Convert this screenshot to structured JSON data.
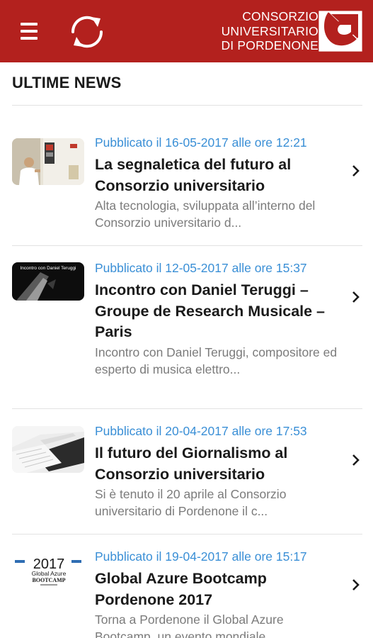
{
  "header": {
    "logo_lines": [
      "CONSORZIO",
      "UNIVERSITARIO",
      "DI PORDENONE"
    ],
    "brand_color": "#b3211e",
    "menu_icon": "hamburger-menu-icon",
    "refresh_icon": "refresh-icon"
  },
  "section": {
    "title": "ULTIME NEWS"
  },
  "news": [
    {
      "date": "Pubblicato il 16-05-2017 alle ore 12:21",
      "title": "La segnaletica del futuro al Consorzio universitario",
      "excerpt": "Alta tecnologia, sviluppata all’interno del Consorzio universitario d..."
    },
    {
      "date": "Pubblicato il 12-05-2017 alle ore 15:37",
      "title": "Incontro con Daniel Teruggi – Groupe de Research Musicale – Paris",
      "excerpt": "Incontro con Daniel Teruggi, compositore ed esperto di musica elettro...",
      "thumb_caption": "Incontro con Daniel Teruggi"
    },
    {
      "date": "Pubblicato il 20-04-2017 alle ore 17:53",
      "title": "Il futuro del Giornalismo al Consorzio universitario",
      "excerpt": "Si è tenuto il 20 aprile al Consorzio universitario di Pordenone il c..."
    },
    {
      "date": "Pubblicato il 19-04-2017 alle ore 15:17",
      "title": "Global Azure Bootcamp Pordenone 2017",
      "excerpt": "Torna a Pordenone il Global Azure Bootcamp, un evento mondiale...",
      "thumb_year": "2017",
      "thumb_line1": "Global Azure",
      "thumb_line2": "BOOTCAMP"
    }
  ],
  "colors": {
    "date_blue": "#3a8fd6",
    "title_text": "#1a1a1a",
    "excerpt_gray": "#7b7b7b",
    "divider": "#e2e2e2"
  }
}
